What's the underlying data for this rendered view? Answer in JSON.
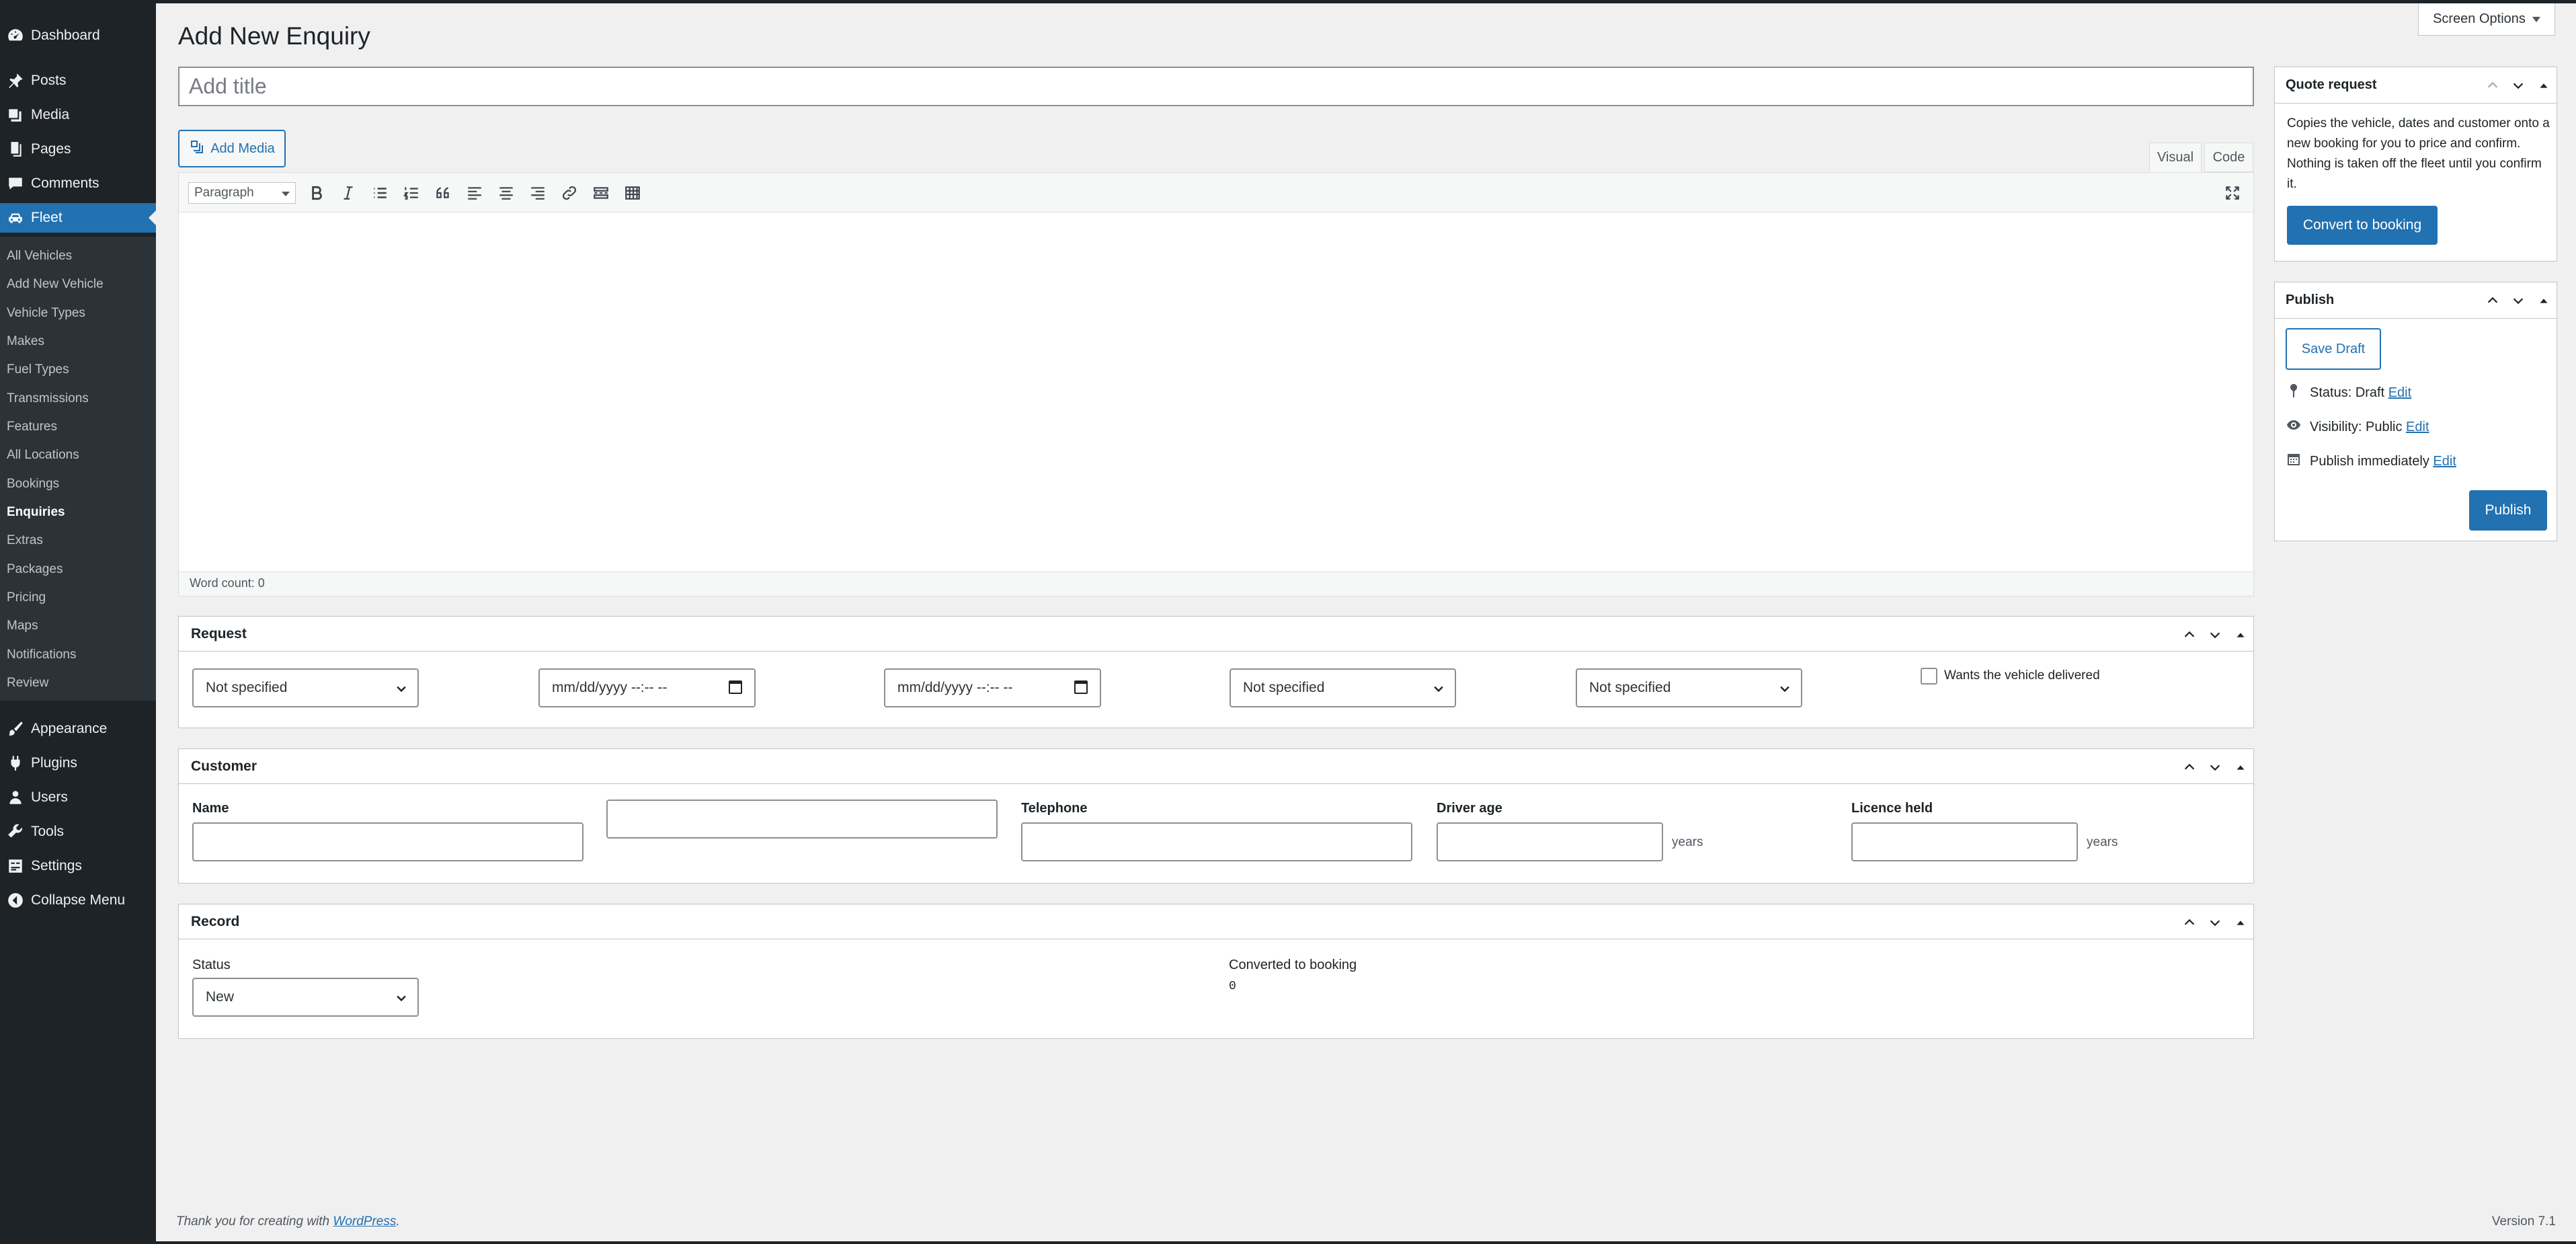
{
  "sidebar": {
    "top_items": [
      {
        "label": "Dashboard",
        "icon": "dashboard-icon"
      },
      {
        "label": "Posts",
        "icon": "pin-icon"
      },
      {
        "label": "Media",
        "icon": "media-icon"
      },
      {
        "label": "Pages",
        "icon": "pages-icon"
      },
      {
        "label": "Comments",
        "icon": "comments-icon"
      },
      {
        "label": "Fleet",
        "icon": "car-icon"
      }
    ],
    "submenu": [
      "All Vehicles",
      "Add New Vehicle",
      "Vehicle Types",
      "Makes",
      "Fuel Types",
      "Transmissions",
      "Features",
      "All Locations",
      "Bookings",
      "Enquiries",
      "Extras",
      "Packages",
      "Pricing",
      "Maps",
      "Notifications",
      "Review"
    ],
    "bottom_items": [
      {
        "label": "Appearance",
        "icon": "brush-icon"
      },
      {
        "label": "Plugins",
        "icon": "plugin-icon"
      },
      {
        "label": "Users",
        "icon": "users-icon"
      },
      {
        "label": "Tools",
        "icon": "wrench-icon"
      },
      {
        "label": "Settings",
        "icon": "settings-icon"
      },
      {
        "label": "Collapse Menu",
        "icon": "collapse-icon"
      }
    ]
  },
  "header": {
    "screen_options": "Screen Options",
    "page_title": "Add New Enquiry",
    "title_placeholder": "Add title"
  },
  "editor": {
    "add_media": "Add Media",
    "tab_visual": "Visual",
    "tab_code": "Code",
    "format_select": "Paragraph",
    "word_count": "Word count: 0"
  },
  "request": {
    "title": "Request",
    "select1": "Not specified",
    "date1": "mm/dd/yyyy --:-- --",
    "date2": "mm/dd/yyyy --:-- --",
    "select2": "Not specified",
    "select3": "Not specified",
    "delivery_label": "Wants the vehicle delivered"
  },
  "customer": {
    "title": "Customer",
    "name_label": "Name",
    "telephone_label": "Telephone",
    "driver_age_label": "Driver age",
    "licence_label": "Licence held",
    "years1": "years",
    "years2": "years"
  },
  "record": {
    "title": "Record",
    "status_label": "Status",
    "status_value": "New",
    "converted_label": "Converted to booking",
    "converted_value": "0"
  },
  "quote": {
    "title": "Quote request",
    "description": "Copies the vehicle, dates and customer onto a new booking for you to price and confirm. Nothing is taken off the fleet until you confirm it.",
    "convert_button": "Convert to booking"
  },
  "publish": {
    "title": "Publish",
    "save_draft": "Save Draft",
    "status_label": "Status: ",
    "status_value": "Draft",
    "visibility_label": "Visibility: ",
    "visibility_value": "Public",
    "publish_label": "Publish ",
    "publish_value": "immediately",
    "edit": "Edit",
    "publish_button": "Publish"
  },
  "footer": {
    "thanks_prefix": "Thank you for creating with ",
    "thanks_link": "WordPress",
    "thanks_suffix": ".",
    "version": "Version 7.1"
  },
  "colors": {
    "sidebar": "#1d2327",
    "accent": "#2271b1",
    "background": "#f0f0f1"
  }
}
